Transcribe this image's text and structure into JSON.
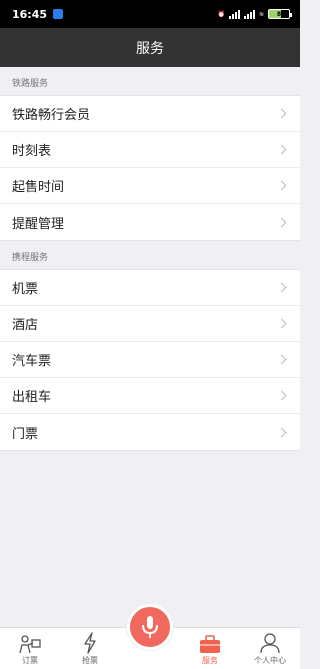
{
  "status": {
    "time": "16:45",
    "battery": "8"
  },
  "header": {
    "title": "服务"
  },
  "sections": [
    {
      "title": "铁路服务",
      "items": [
        "铁路畅行会员",
        "时刻表",
        "起售时间",
        "提醒管理"
      ]
    },
    {
      "title": "携程服务",
      "items": [
        "机票",
        "酒店",
        "汽车票",
        "出租车",
        "门票"
      ]
    }
  ],
  "tabbar": {
    "items": [
      {
        "label": "订票",
        "icon": "booking-icon"
      },
      {
        "label": "抢票",
        "icon": "lightning-icon"
      },
      {
        "label": "",
        "icon": "microphone-icon"
      },
      {
        "label": "服务",
        "icon": "suitcase-icon",
        "active": true
      },
      {
        "label": "个人中心",
        "icon": "person-icon"
      }
    ]
  },
  "colors": {
    "accent": "#f0624c",
    "nav": "#333333",
    "background": "#efeff4"
  }
}
